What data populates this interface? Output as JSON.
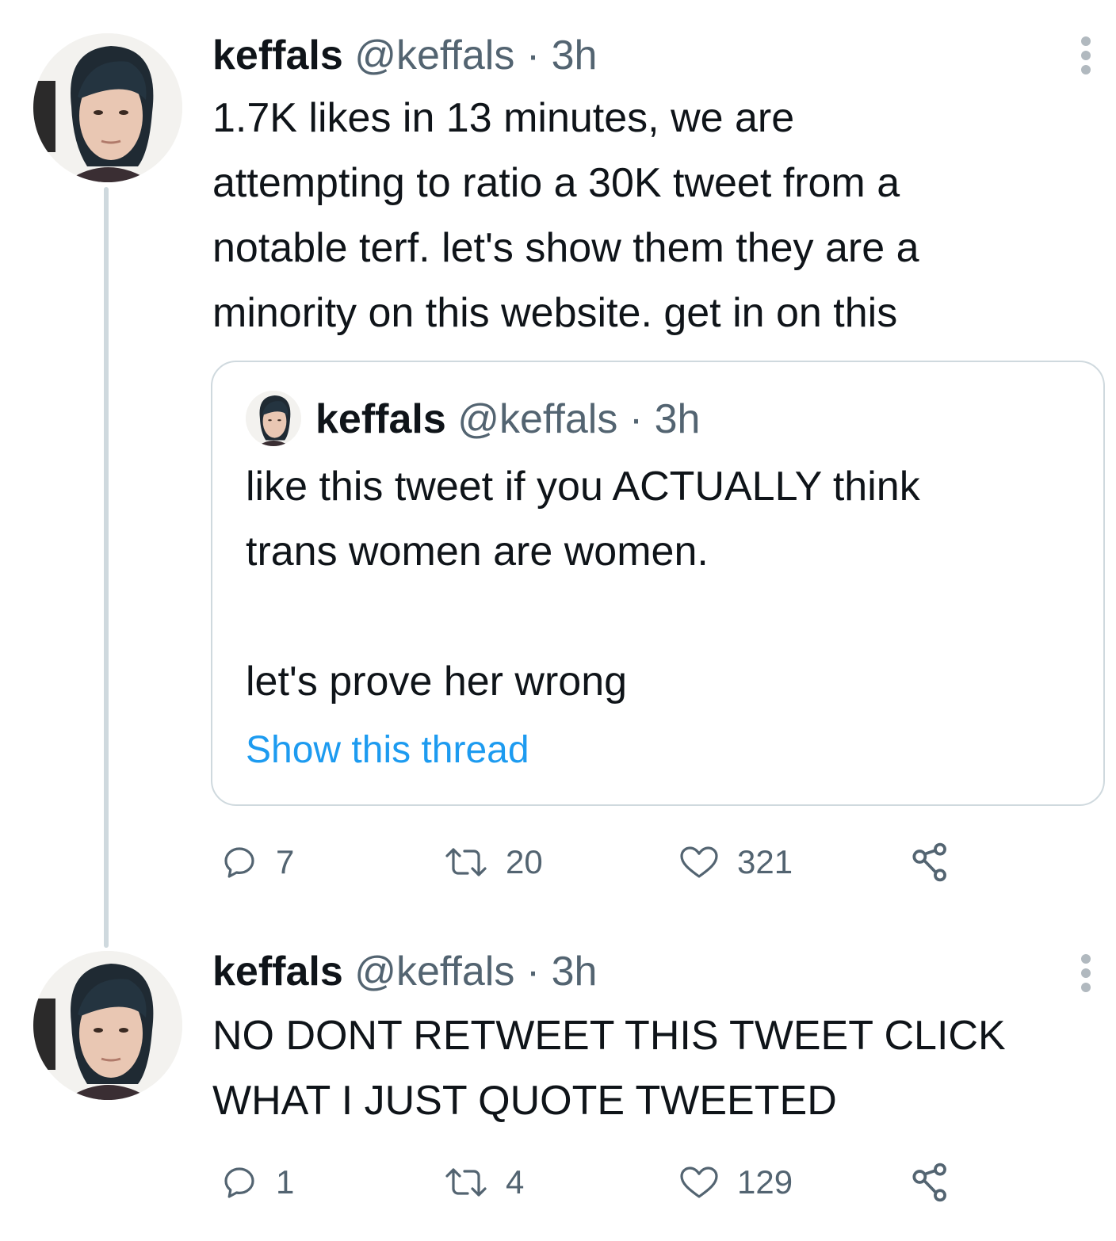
{
  "tweets": [
    {
      "name": "keffals",
      "handle": "@keffals",
      "separator": "·",
      "time": "3h",
      "text_lines": [
        "1.7K likes in 13 minutes, we are",
        "attempting to ratio a 30K tweet from a",
        "notable terf. let's show them they are a",
        "minority on this website. get in on this"
      ],
      "quoted": {
        "name": "keffals",
        "handle": "@keffals",
        "separator": "·",
        "time": "3h",
        "text": "like this tweet if you ACTUALLY think\ntrans women are women.\n\nlet's prove her wrong",
        "show_thread": "Show this thread"
      },
      "actions": {
        "reply": "7",
        "retweet": "20",
        "like": "321"
      }
    },
    {
      "name": "keffals",
      "handle": "@keffals",
      "separator": "·",
      "time": "3h",
      "text_lines": [
        "NO DONT RETWEET THIS TWEET CLICK",
        "WHAT I JUST QUOTE TWEETED"
      ],
      "actions": {
        "reply": "1",
        "retweet": "4",
        "like": "129"
      }
    }
  ],
  "icons": {
    "reply": "reply-icon",
    "retweet": "retweet-icon",
    "like": "heart-icon",
    "share": "share-icon",
    "more": "more-options-icon"
  },
  "colors": {
    "text": "#0f1419",
    "muted": "#536471",
    "link": "#1d9bf0",
    "border": "#cfd9de"
  }
}
